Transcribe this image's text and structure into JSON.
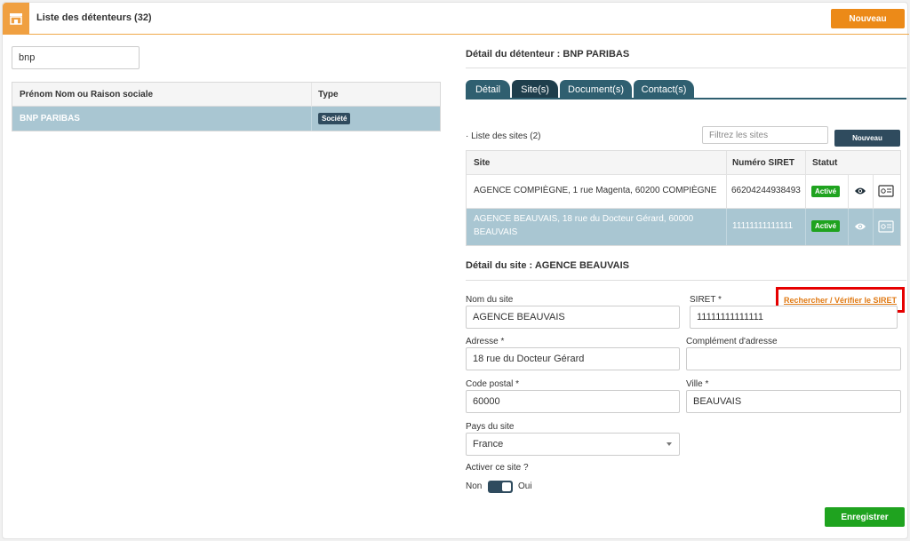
{
  "header": {
    "title": "Liste des détenteurs (32)",
    "new_button": "Nouveau"
  },
  "left": {
    "search_value": "bnp",
    "table": {
      "columns": [
        "Prénom Nom ou Raison sociale",
        "Type"
      ],
      "rows": [
        {
          "name": "BNP PARIBAS",
          "type": "Société"
        }
      ]
    }
  },
  "detail": {
    "title": "Détail du détenteur : BNP PARIBAS",
    "tabs": [
      "Détail",
      "Site(s)",
      "Document(s)",
      "Contact(s)"
    ],
    "active_tab": "Site(s)",
    "sites_label": "Liste des sites (2)",
    "filter_placeholder": "Filtrez les sites",
    "new_site_button": "Nouveau",
    "sites_table": {
      "columns": [
        "Site",
        "Numéro SIRET",
        "Statut"
      ],
      "rows": [
        {
          "site": "AGENCE COMPIÈGNE, 1 rue Magenta, 60200 COMPIÈGNE",
          "siret": "66204244938493",
          "status": "Activé"
        },
        {
          "site_line1": "AGENCE BEAUVAIS, 18 rue du Docteur Gérard, 60000",
          "site_line2": "BEAUVAIS",
          "siret": "11111111111111",
          "status": "Activé"
        }
      ]
    }
  },
  "site_detail": {
    "title": "Détail du site : AGENCE BEAUVAIS",
    "nom_label": "Nom du site",
    "nom_value": "AGENCE BEAUVAIS",
    "siret_label": "SIRET *",
    "siret_value": "11111111111111",
    "siret_link": "Rechercher / Vérifier le SIRET",
    "adresse_label": "Adresse *",
    "adresse_value": "18 rue du Docteur Gérard",
    "complement_label": "Complément d'adresse",
    "complement_value": "",
    "cp_label": "Code postal *",
    "cp_value": "60000",
    "ville_label": "Ville *",
    "ville_value": "BEAUVAIS",
    "pays_label": "Pays du site",
    "pays_value": "France",
    "activer_label": "Activer ce site ?",
    "toggle_off": "Non",
    "toggle_on": "Oui",
    "save_button": "Enregistrer"
  },
  "colors": {
    "orange": "#ec8a18",
    "dark": "#2f4b5e",
    "selected_row": "#a9c6d2",
    "green": "#1fa31f",
    "highlight": "#e60000"
  }
}
